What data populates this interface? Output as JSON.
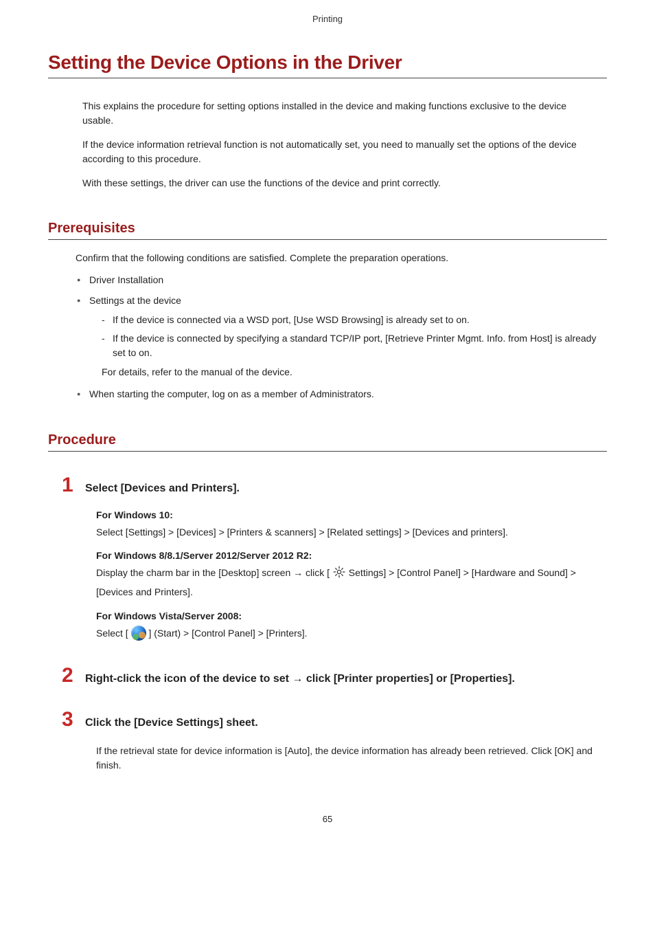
{
  "header": {
    "category": "Printing"
  },
  "title": "Setting the Device Options in the Driver",
  "intro": {
    "p1": "This explains the procedure for setting options installed in the device and making functions exclusive to the device usable.",
    "p2": "If the device information retrieval function is not automatically set, you need to manually set the options of the device according to this procedure.",
    "p3": "With these settings, the driver can use the functions of the device and print correctly."
  },
  "prereq": {
    "heading": "Prerequisites",
    "lead": "Confirm that the following conditions are satisfied. Complete the preparation operations.",
    "items": {
      "i1": "Driver Installation",
      "i2": "Settings at the device",
      "i2_sub1": "If the device is connected via a WSD port, [Use WSD Browsing] is already set to on.",
      "i2_sub2": "If the device is connected by specifying a standard TCP/IP port, [Retrieve Printer Mgmt. Info. from Host] is already set to on.",
      "i2_note": "For details, refer to the manual of the device.",
      "i3": "When starting the computer, log on as a member of Administrators."
    }
  },
  "procedure": {
    "heading": "Procedure",
    "step1": {
      "num": "1",
      "title": "Select [Devices and Printers].",
      "win10_h": "For Windows 10:",
      "win10_b": "Select [Settings] > [Devices] > [Printers & scanners] > [Related settings] > [Devices and printers].",
      "win8_h": "For Windows 8/8.1/Server 2012/Server 2012 R2:",
      "win8_b_pre": "Display the charm bar in the [Desktop] screen → click [ ",
      "win8_b_post": " Settings] > [Control Panel] > [Hardware and Sound] > [Devices and Printers].",
      "vista_h": "For Windows Vista/Server 2008:",
      "vista_b_pre": "Select [ ",
      "vista_b_post": " ] (Start) > [Control Panel] > [Printers]."
    },
    "step2": {
      "num": "2",
      "title": "Right-click the icon of the device to set → click [Printer properties] or [Properties]."
    },
    "step3": {
      "num": "3",
      "title": "Click the [Device Settings] sheet.",
      "body": "If the retrieval state for device information is [Auto], the device information has already been retrieved. Click [OK] and finish."
    }
  },
  "page_number": "65"
}
